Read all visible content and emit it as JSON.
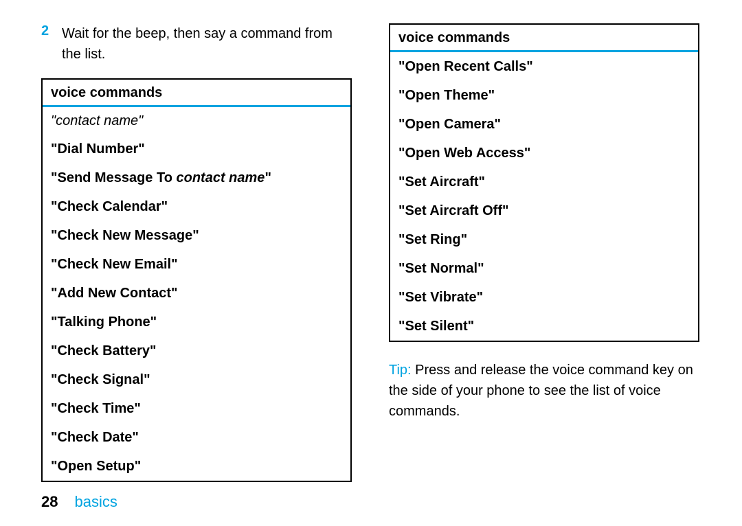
{
  "step": {
    "number": "2",
    "text": "Wait for the beep, then say a command from the list."
  },
  "table_header": "voice commands",
  "left_commands": [
    {
      "text": "\"contact name\"",
      "style": "first-italic"
    },
    {
      "text": "\"Dial Number\"",
      "style": "bold"
    },
    {
      "prefix": "\"Send Message To ",
      "italic": "contact name",
      "suffix": "\"",
      "style": "mixed"
    },
    {
      "text": "\"Check Calendar\"",
      "style": "bold"
    },
    {
      "text": "\"Check New Message\"",
      "style": "bold"
    },
    {
      "text": "\"Check New Email\"",
      "style": "bold"
    },
    {
      "text": "\"Add New Contact\"",
      "style": "bold"
    },
    {
      "text": "\"Talking Phone\"",
      "style": "bold"
    },
    {
      "text": "\"Check Battery\"",
      "style": "bold"
    },
    {
      "text": "\"Check Signal\"",
      "style": "bold"
    },
    {
      "text": "\"Check Time\"",
      "style": "bold"
    },
    {
      "text": "\"Check Date\"",
      "style": "bold"
    },
    {
      "text": "\"Open Setup\"",
      "style": "bold"
    }
  ],
  "right_commands": [
    {
      "text": "\"Open Recent Calls\"",
      "style": "bold"
    },
    {
      "text": "\"Open Theme\"",
      "style": "bold"
    },
    {
      "text": "\"Open Camera\"",
      "style": "bold"
    },
    {
      "text": "\"Open Web Access\"",
      "style": "bold"
    },
    {
      "text": "\"Set Aircraft\"",
      "style": "bold"
    },
    {
      "text": "\"Set Aircraft Off\"",
      "style": "bold"
    },
    {
      "text": "\"Set Ring\"",
      "style": "bold"
    },
    {
      "text": "\"Set Normal\"",
      "style": "bold"
    },
    {
      "text": "\"Set Vibrate\"",
      "style": "bold"
    },
    {
      "text": "\"Set Silent\"",
      "style": "bold"
    }
  ],
  "tip": {
    "label": "Tip:",
    "text": " Press and release the voice command key on the side of your phone to see the list of voice commands."
  },
  "footer": {
    "page": "28",
    "section": "basics"
  }
}
